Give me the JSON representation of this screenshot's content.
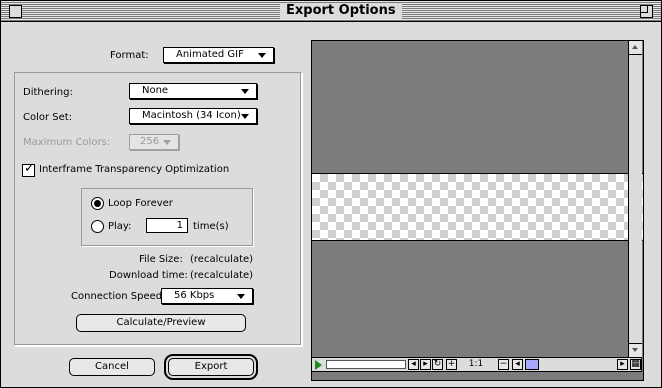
{
  "window": {
    "title": "Export Options"
  },
  "format": {
    "label": "Format:",
    "value": "Animated GIF"
  },
  "dithering": {
    "label": "Dithering:",
    "value": "None"
  },
  "color_set": {
    "label": "Color Set:",
    "value": "Macintosh (34 Icon)"
  },
  "max_colors": {
    "label": "Maximum Colors:",
    "value": "256",
    "enabled": false
  },
  "interframe": {
    "label": "Interframe Transparency Optimization",
    "checked": true
  },
  "loop": {
    "forever_label": "Loop Forever",
    "play_label": "Play:",
    "play_count": "1",
    "unit": "time(s)",
    "selected": "forever"
  },
  "file_size": {
    "label": "File Size:",
    "value": "(recalculate)"
  },
  "download_time": {
    "label": "Download time:",
    "value": "(recalculate)"
  },
  "connection_speed": {
    "label": "Connection Speed:",
    "value": "56 Kbps"
  },
  "buttons": {
    "calculate": "Calculate/Preview",
    "cancel": "Cancel",
    "export": "Export"
  },
  "preview_controls": {
    "zoom": "1:1"
  },
  "colors": {
    "preview_bg": "#7c7c7c",
    "window_bg": "#dcdcdc",
    "play_green": "#1a8f1a"
  }
}
